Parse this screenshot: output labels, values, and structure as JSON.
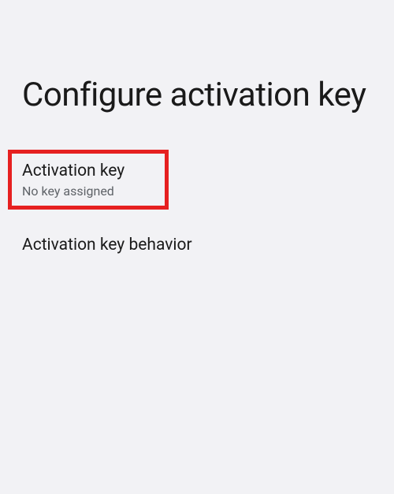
{
  "page": {
    "title": "Configure activation key"
  },
  "settings": {
    "activationKey": {
      "title": "Activation key",
      "subtitle": "No key assigned"
    },
    "activationKeyBehavior": {
      "title": "Activation key behavior"
    }
  }
}
